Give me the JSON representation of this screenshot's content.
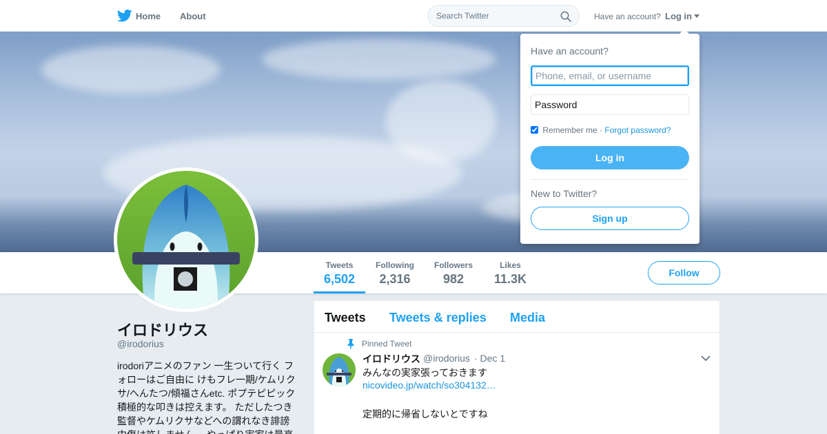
{
  "nav": {
    "home_label": "Home",
    "about_label": "About",
    "search_placeholder": "Search Twitter",
    "have_account_label": "Have an account?",
    "login_label": "Log in",
    "brand_color": "#1da1f2"
  },
  "profile": {
    "name": "イロドリウス",
    "handle": "@irodorius",
    "bio": [
      "irodoriアニメのファン 一生ついて行く フ",
      "ォローはご自由に けもフレ一期/ケムリク",
      "サ/へんたつ/傾福さんetc. ポプテピピック",
      "積極的な叩きは控えます。 ただしたつき",
      "監督やケムリクサなどへの謂れなき誹謗",
      "中傷は許しません。 やっぱり実家は最高"
    ],
    "follow_label": "Follow"
  },
  "stats": [
    {
      "label": "Tweets",
      "value": "6,502",
      "active": true
    },
    {
      "label": "Following",
      "value": "2,316",
      "active": false
    },
    {
      "label": "Followers",
      "value": "982",
      "active": false
    },
    {
      "label": "Likes",
      "value": "11.3K",
      "active": false
    }
  ],
  "timeline": {
    "tabs": [
      "Tweets",
      "Tweets & replies",
      "Media"
    ],
    "pinned_label": "Pinned Tweet",
    "tweet": {
      "name": "イロドリウス",
      "handle": "@irodorius",
      "date": "· Dec 1",
      "text": "みんなの実家張っておきます",
      "link": "nicovideo.jp/watch/so304132…",
      "text2": "定期的に帰省しないとですね"
    }
  },
  "login_dropdown": {
    "title": "Have an account?",
    "username_placeholder": "Phone, email, or username",
    "password_placeholder": "Password",
    "remember_label": "Remember me",
    "separator": "·",
    "forgot_label": "Forgot password?",
    "remember_checked": true,
    "login_button": "Log in",
    "new_label": "New to Twitter?",
    "signup_button": "Sign up"
  }
}
